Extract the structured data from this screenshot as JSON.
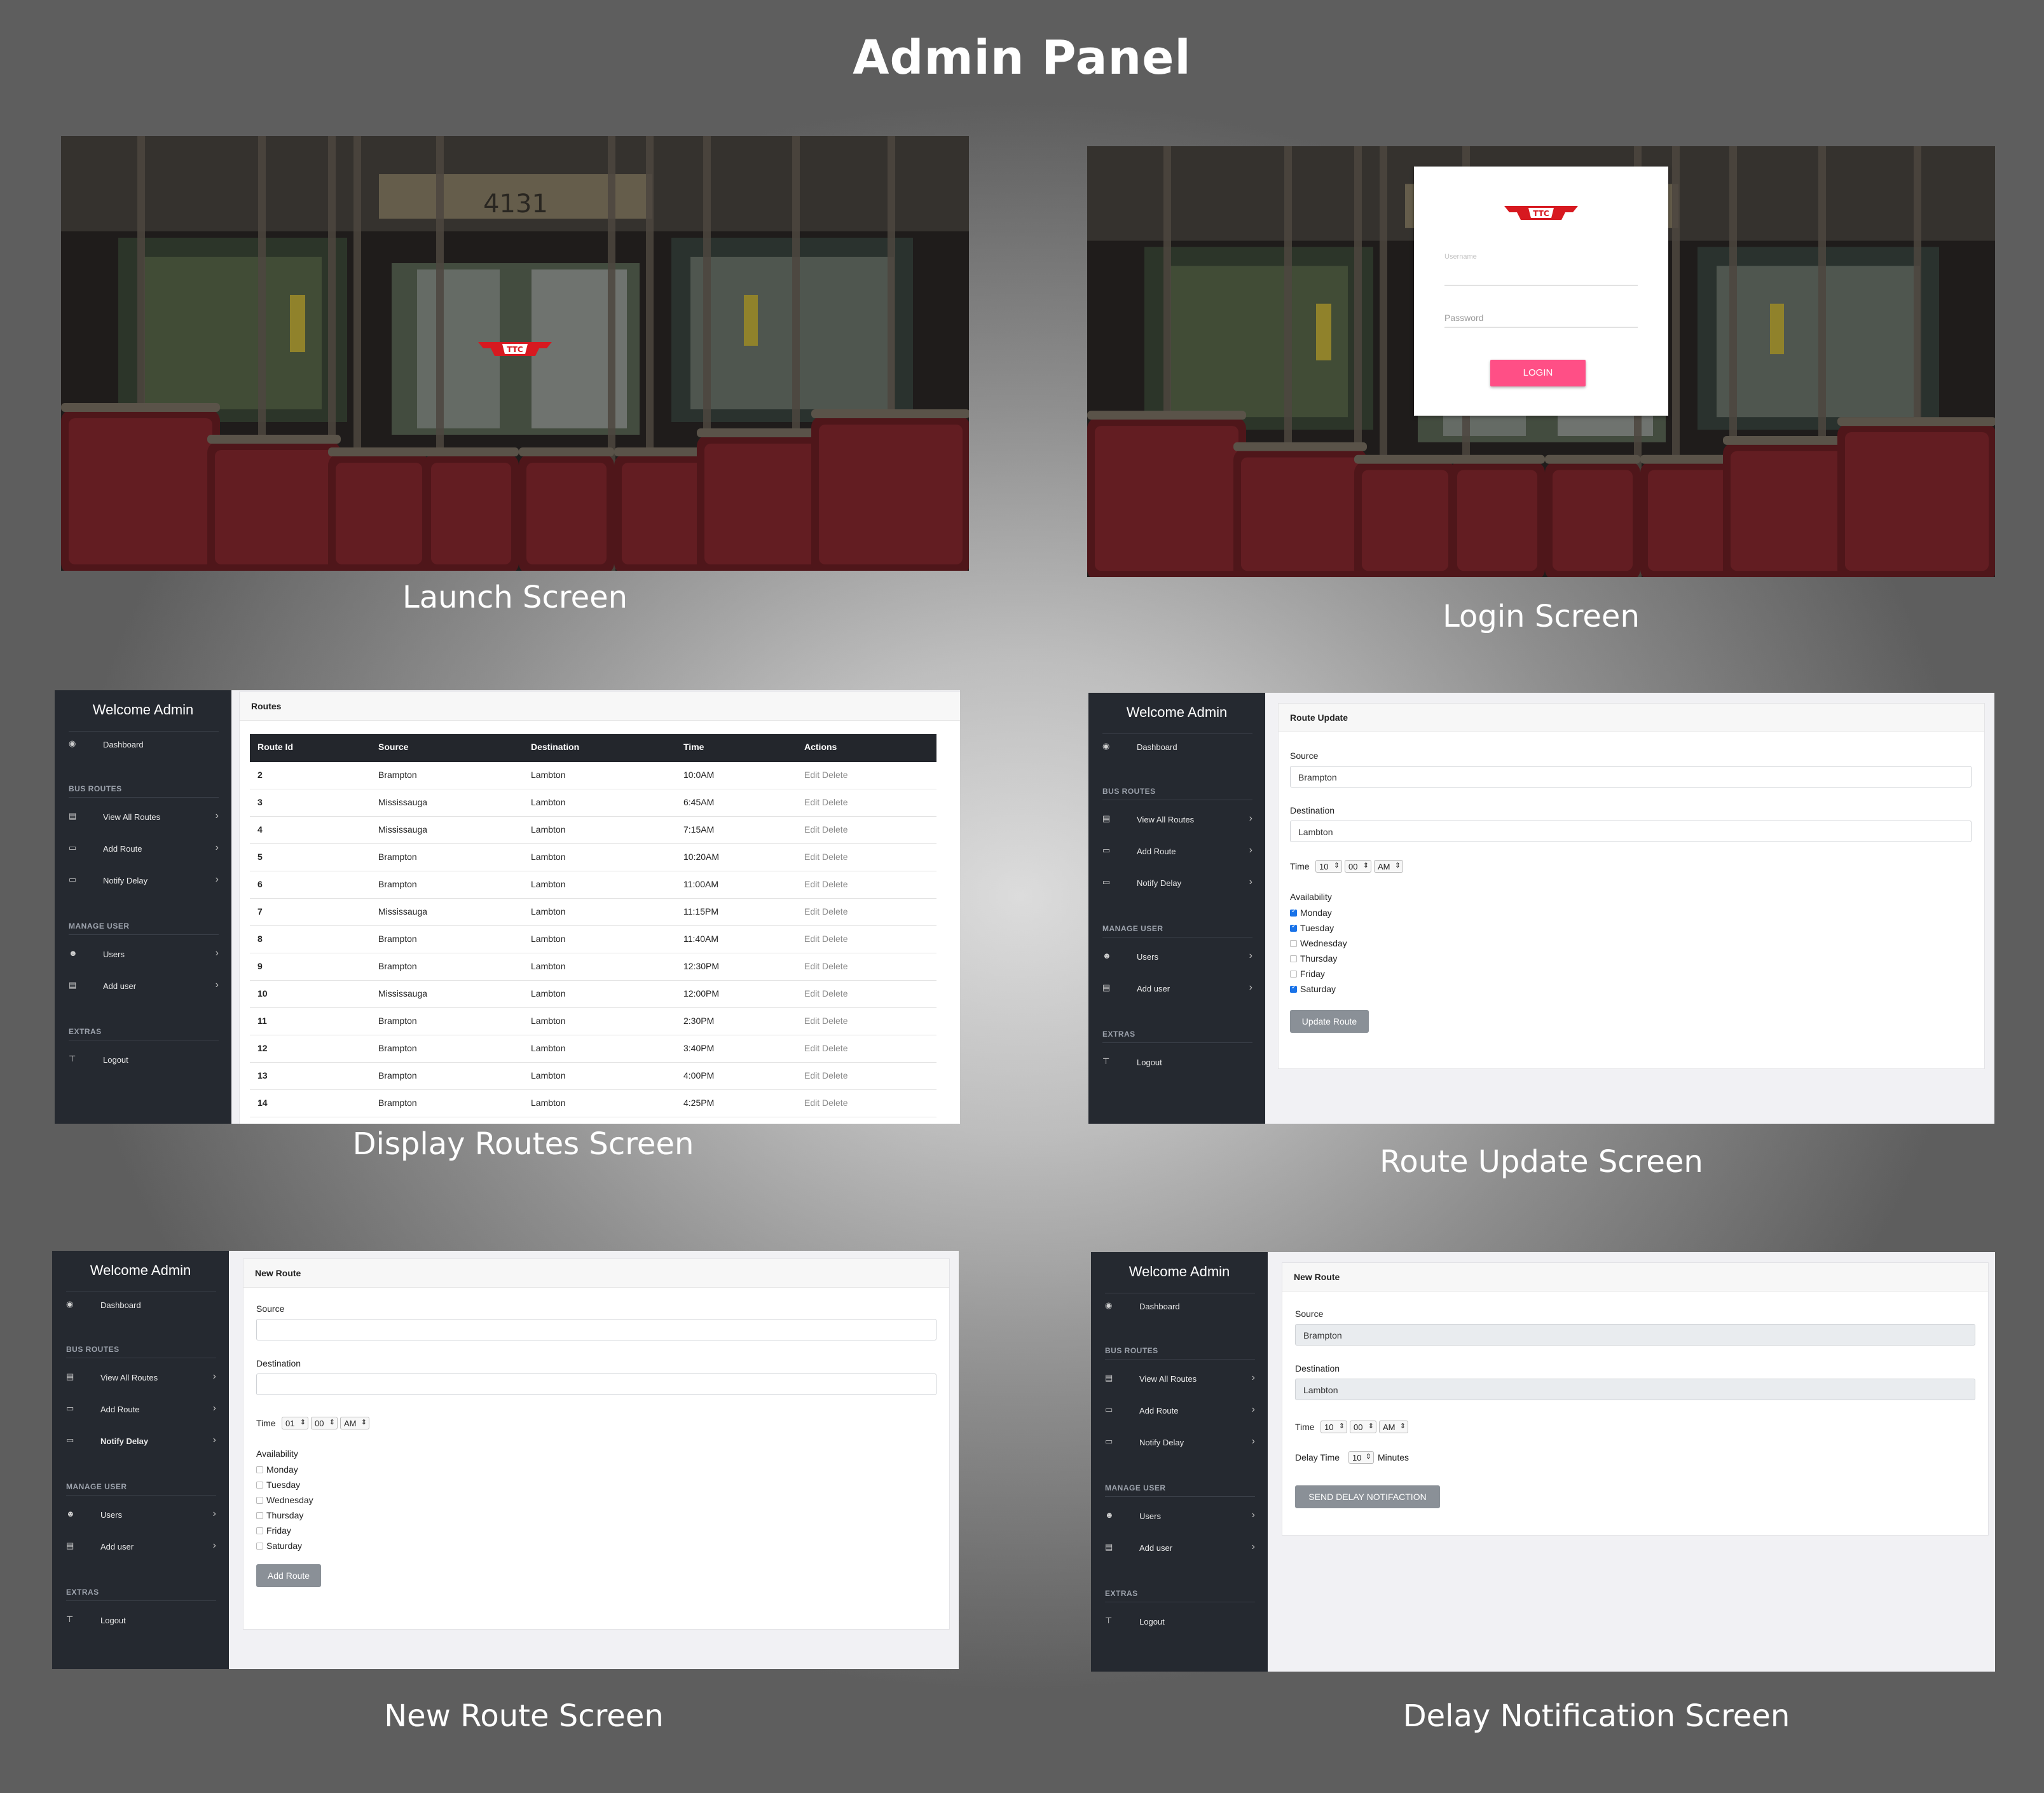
{
  "page_title": "Admin Panel",
  "captions": {
    "launch": "Launch Screen",
    "login": "Login Screen",
    "display_routes": "Display Routes Screen",
    "route_update": "Route Update Screen",
    "new_route": "New Route Screen",
    "delay_notification": "Delay Notification Screen"
  },
  "photo": {
    "bus_number": "4131"
  },
  "logo": {
    "text": "TTC"
  },
  "login": {
    "username_placeholder": "Username",
    "password_placeholder": "Password",
    "login_button": "LOGIN",
    "button_color": "#ff4f86"
  },
  "sidebar": {
    "title": "Welcome Admin",
    "dashboard": "Dashboard",
    "bus_routes_heading": "BUS ROUTES",
    "view_all_routes": "View All Routes",
    "add_route": "Add Route",
    "notify_delay": "Notify Delay",
    "manage_user_heading": "MANAGE USER",
    "users": "Users",
    "add_user": "Add user",
    "extras_heading": "EXTRAS",
    "logout": "Logout",
    "chevron": "›"
  },
  "routes_screen": {
    "card_title": "Routes",
    "columns": [
      "Route Id",
      "Source",
      "Destination",
      "Time",
      "Actions"
    ],
    "rows": [
      [
        "2",
        "Brampton",
        "Lambton",
        "10:0AM",
        "Edit Delete"
      ],
      [
        "3",
        "Mississauga",
        "Lambton",
        "6:45AM",
        "Edit Delete"
      ],
      [
        "4",
        "Mississauga",
        "Lambton",
        "7:15AM",
        "Edit Delete"
      ],
      [
        "5",
        "Brampton",
        "Lambton",
        "10:20AM",
        "Edit Delete"
      ],
      [
        "6",
        "Brampton",
        "Lambton",
        "11:00AM",
        "Edit Delete"
      ],
      [
        "7",
        "Mississauga",
        "Lambton",
        "11:15PM",
        "Edit Delete"
      ],
      [
        "8",
        "Brampton",
        "Lambton",
        "11:40AM",
        "Edit Delete"
      ],
      [
        "9",
        "Brampton",
        "Lambton",
        "12:30PM",
        "Edit Delete"
      ],
      [
        "10",
        "Mississauga",
        "Lambton",
        "12:00PM",
        "Edit Delete"
      ],
      [
        "11",
        "Brampton",
        "Lambton",
        "2:30PM",
        "Edit Delete"
      ],
      [
        "12",
        "Brampton",
        "Lambton",
        "3:40PM",
        "Edit Delete"
      ],
      [
        "13",
        "Brampton",
        "Lambton",
        "4:00PM",
        "Edit Delete"
      ],
      [
        "14",
        "Brampton",
        "Lambton",
        "4:25PM",
        "Edit Delete"
      ]
    ]
  },
  "route_update_screen": {
    "card_title": "Route Update",
    "source_label": "Source",
    "source_value": "Brampton",
    "destination_label": "Destination",
    "destination_value": "Lambton",
    "time_label": "Time",
    "hour": "10",
    "minute": "00",
    "ampm": "AM",
    "availability_label": "Availability",
    "days": [
      {
        "name": "Monday",
        "checked": true
      },
      {
        "name": "Tuesday",
        "checked": true
      },
      {
        "name": "Wednesday",
        "checked": false
      },
      {
        "name": "Thursday",
        "checked": false
      },
      {
        "name": "Friday",
        "checked": false
      },
      {
        "name": "Saturday",
        "checked": true
      }
    ],
    "button": "Update Route"
  },
  "new_route_screen": {
    "card_title": "New Route",
    "source_label": "Source",
    "source_value": "",
    "destination_label": "Destination",
    "destination_value": "",
    "time_label": "Time",
    "hour": "01",
    "minute": "00",
    "ampm": "AM",
    "availability_label": "Availability",
    "days": [
      {
        "name": "Monday",
        "checked": false
      },
      {
        "name": "Tuesday",
        "checked": false
      },
      {
        "name": "Wednesday",
        "checked": false
      },
      {
        "name": "Thursday",
        "checked": false
      },
      {
        "name": "Friday",
        "checked": false
      },
      {
        "name": "Saturday",
        "checked": false
      }
    ],
    "button": "Add Route"
  },
  "delay_screen": {
    "card_title": "New Route",
    "source_label": "Source",
    "source_value": "Brampton",
    "destination_label": "Destination",
    "destination_value": "Lambton",
    "time_label": "Time",
    "hour": "10",
    "minute": "00",
    "ampm": "AM",
    "delay_time_label": "Delay Time",
    "delay_value": "10",
    "minutes_label": "Minutes",
    "button": "SEND DELAY NOTIFACTION"
  }
}
